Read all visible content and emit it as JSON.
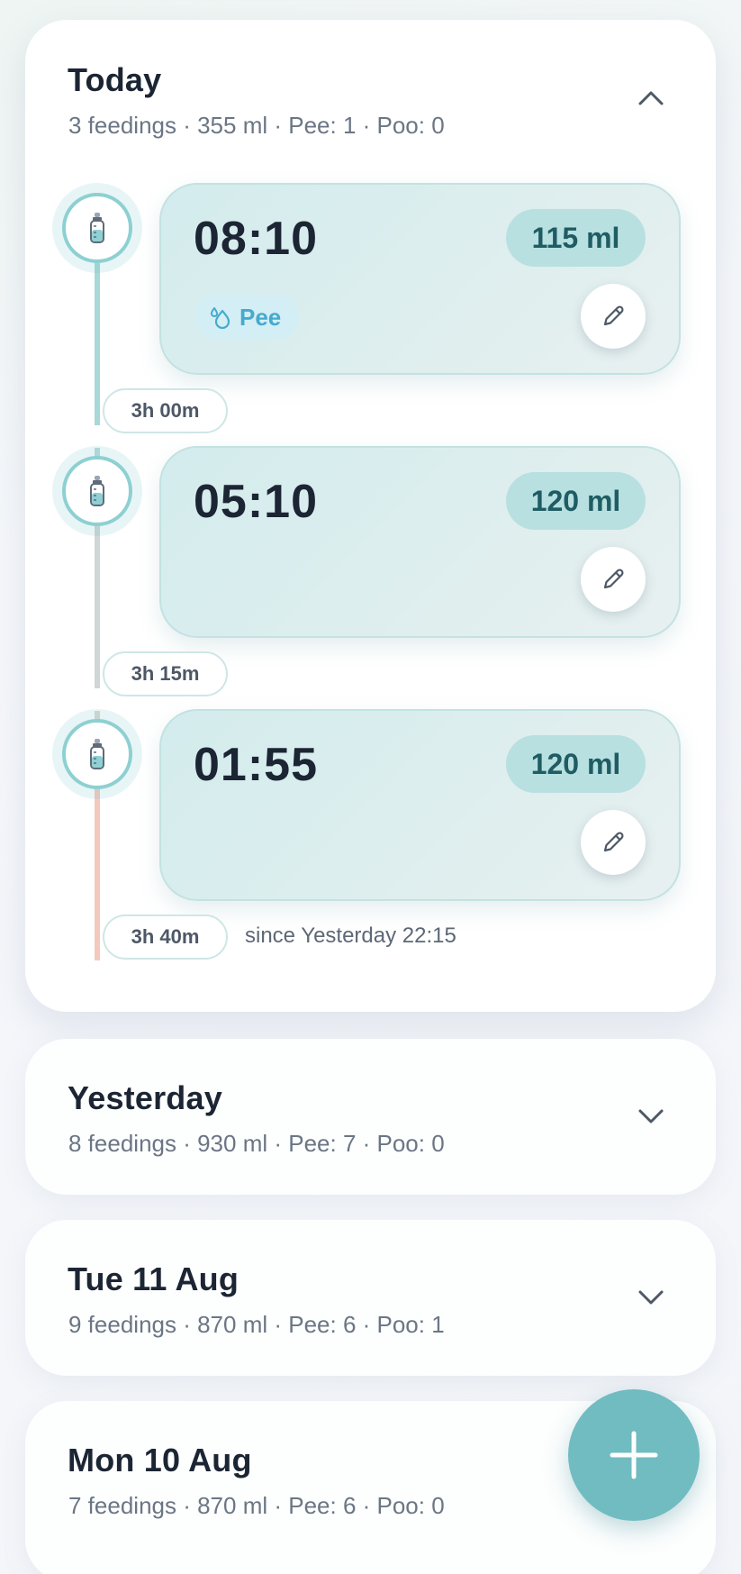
{
  "days": {
    "today": {
      "title": "Today",
      "summary": "3 feedings · 355 ml · Pee: 1 · Poo: 0",
      "expanded": true,
      "feedings": [
        {
          "time": "08:10",
          "amount": "115 ml",
          "tag": "Pee",
          "icon": "baby-bottle-icon"
        },
        {
          "time": "05:10",
          "amount": "120 ml",
          "icon": "baby-bottle-icon"
        },
        {
          "time": "01:55",
          "amount": "120 ml",
          "icon": "baby-bottle-icon"
        }
      ],
      "intervals": [
        "3h 00m",
        "3h 15m",
        "3h 40m"
      ],
      "since_label": "since Yesterday 22:15"
    },
    "yesterday": {
      "title": "Yesterday",
      "summary": "8 feedings · 930 ml · Pee: 7 · Poo: 0",
      "expanded": false
    },
    "tue": {
      "title": "Tue 11 Aug",
      "summary": "9 feedings · 870 ml · Pee: 6 · Poo: 1",
      "expanded": false
    },
    "mon": {
      "title": "Mon 10 Aug",
      "summary": "7 feedings · 870 ml · Pee: 6 · Poo: 0",
      "expanded": false
    }
  },
  "icons": {
    "collapse": "chevron-up-icon",
    "expand": "chevron-down-icon",
    "edit": "pencil-icon",
    "pee": "water-drops-icon",
    "add": "plus-icon"
  },
  "colors": {
    "accent": "#70bcc1",
    "feed_card": "#d3eced",
    "amount_badge": "#b8e0e0",
    "amount_text": "#1f5c63",
    "pee_text": "#46aacd",
    "pee_bg": "#d4eef6",
    "timeline_teal": "#a8d8d8",
    "timeline_gray": "#cfd6d6",
    "timeline_peach": "#f3c9bd"
  }
}
